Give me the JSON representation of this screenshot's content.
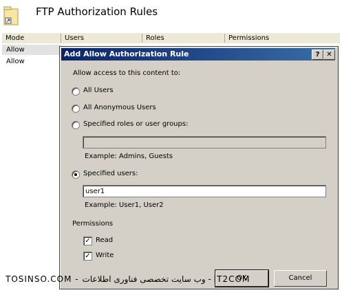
{
  "header": {
    "title": "FTP Authorization Rules",
    "icon": "folder-icon"
  },
  "grid": {
    "columns": [
      "Mode",
      "Users",
      "Roles",
      "Permissions"
    ],
    "rows": [
      "Allow",
      "Allow"
    ]
  },
  "dialog": {
    "title": "Add Allow Authorization Rule",
    "help_label": "?",
    "close_label": "✕",
    "prompt": "Allow access to this content to:",
    "options": {
      "all_users": "All Users",
      "anonymous": "All Anonymous Users",
      "roles": "Specified roles or user groups:",
      "users": "Specified users:"
    },
    "selected": "users",
    "roles_value": "",
    "roles_example": "Example: Admins, Guests",
    "users_value": "user1",
    "users_example": "Example: User1, User2",
    "permissions_label": "Permissions",
    "read_label": "Read",
    "write_label": "Write",
    "read_checked": true,
    "write_checked": true,
    "ok_label": "OK",
    "cancel_label": "Cancel"
  },
  "watermark": "TOSINSO.COM - وب سایت تخصصی فناوری اطلاعات - IT2COM"
}
